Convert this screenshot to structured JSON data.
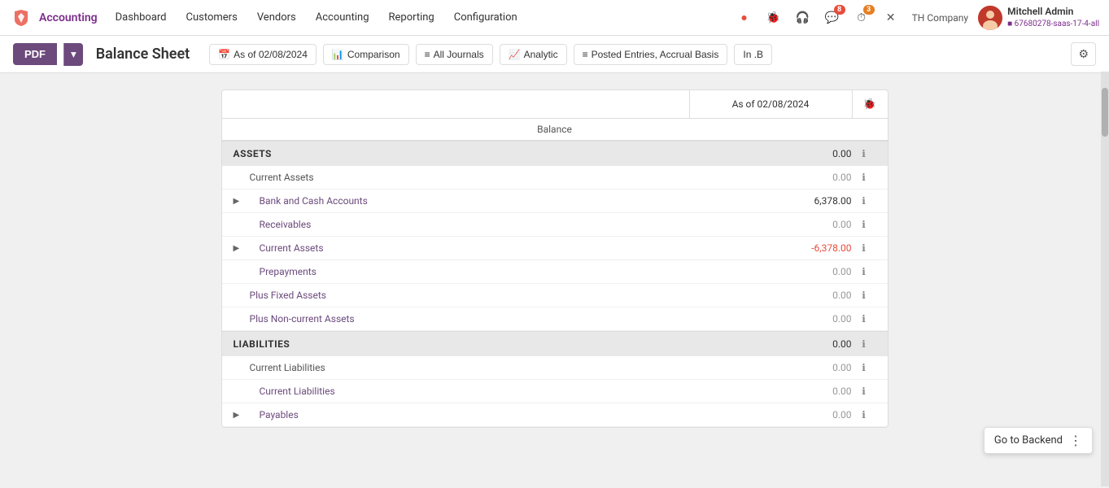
{
  "app": {
    "logo_icon": "✕",
    "brand": "Accounting",
    "nav_items": [
      "Dashboard",
      "Customers",
      "Vendors",
      "Accounting",
      "Reporting",
      "Configuration"
    ]
  },
  "topnav": {
    "icons": [
      {
        "name": "circle-red",
        "symbol": "●",
        "color": "#e74c3c"
      },
      {
        "name": "bug-icon",
        "symbol": "🐛"
      },
      {
        "name": "support-icon",
        "symbol": "🎧"
      },
      {
        "name": "messages-icon",
        "symbol": "💬",
        "badge": "8",
        "badge_color": "red"
      },
      {
        "name": "activity-icon",
        "symbol": "⏱",
        "badge": "3",
        "badge_color": "orange"
      },
      {
        "name": "close-icon",
        "symbol": "✕"
      }
    ],
    "company": "TH Company",
    "user_name": "Mitchell Admin",
    "user_id": "■ 67680278-saas-17-4-all"
  },
  "toolbar": {
    "pdf_label": "PDF",
    "page_title": "Balance Sheet",
    "filters": [
      {
        "name": "date-filter",
        "icon": "📅",
        "label": "As of 02/08/2024"
      },
      {
        "name": "comparison-filter",
        "icon": "📊",
        "label": "Comparison"
      },
      {
        "name": "journals-filter",
        "icon": "📋",
        "label": "All Journals"
      },
      {
        "name": "analytic-filter",
        "icon": "📈",
        "label": "Analytic"
      },
      {
        "name": "entries-filter",
        "icon": "≡",
        "label": "Posted Entries, Accrual Basis"
      },
      {
        "name": "inb-filter",
        "icon": "",
        "label": "In .B"
      }
    ],
    "settings_label": "⚙"
  },
  "report": {
    "date_label": "As of 02/08/2024",
    "balance_label": "Balance",
    "sections": [
      {
        "name": "ASSETS",
        "amount": "0.00",
        "rows": [
          {
            "label": "Current Assets",
            "indent": 0,
            "amount": "0.00",
            "expandable": false,
            "link": false
          },
          {
            "label": "Bank and Cash Accounts",
            "indent": 1,
            "amount": "6,378.00",
            "expandable": true,
            "link": true
          },
          {
            "label": "Receivables",
            "indent": 1,
            "amount": "0.00",
            "expandable": false,
            "link": true,
            "muted": true
          },
          {
            "label": "Current Assets",
            "indent": 1,
            "amount": "-6,378.00",
            "expandable": true,
            "link": true,
            "negative": true
          },
          {
            "label": "Prepayments",
            "indent": 1,
            "amount": "0.00",
            "expandable": false,
            "link": true,
            "muted": true
          },
          {
            "label": "Plus Fixed Assets",
            "indent": 0,
            "amount": "0.00",
            "expandable": false,
            "link": true,
            "muted": true
          },
          {
            "label": "Plus Non-current Assets",
            "indent": 0,
            "amount": "0.00",
            "expandable": false,
            "link": true,
            "muted": true
          }
        ]
      },
      {
        "name": "LIABILITIES",
        "amount": "0.00",
        "rows": [
          {
            "label": "Current Liabilities",
            "indent": 0,
            "amount": "0.00",
            "expandable": false,
            "link": false
          },
          {
            "label": "Current Liabilities",
            "indent": 1,
            "amount": "0.00",
            "expandable": false,
            "link": true,
            "muted": true
          },
          {
            "label": "Payables",
            "indent": 1,
            "amount": "0.00",
            "expandable": true,
            "link": true,
            "muted": true
          }
        ]
      }
    ]
  },
  "goto_backend": {
    "label": "Go to Backend"
  }
}
